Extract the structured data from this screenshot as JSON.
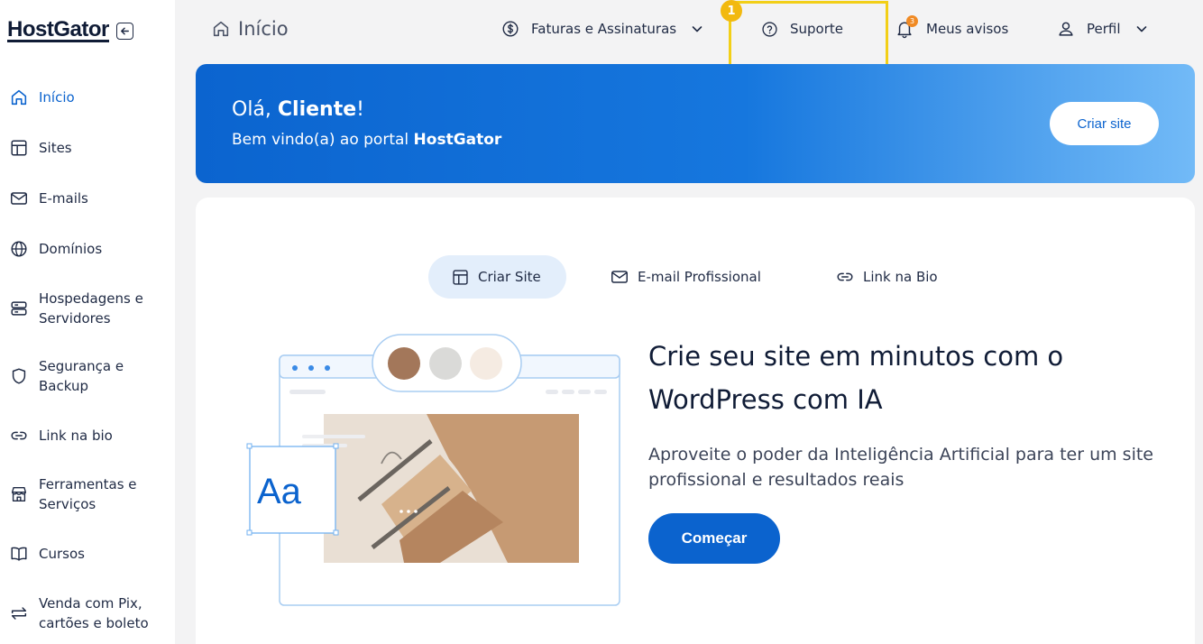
{
  "brand": {
    "logo": "HostGator"
  },
  "sidebar": {
    "items": [
      {
        "label": "Início",
        "icon": "home-icon",
        "active": true
      },
      {
        "label": "Sites",
        "icon": "layout-icon"
      },
      {
        "label": "E-mails",
        "icon": "mail-icon"
      },
      {
        "label": "Domínios",
        "icon": "globe-icon"
      },
      {
        "label": "Hospedagens e Servidores",
        "icon": "server-icon"
      },
      {
        "label": "Segurança e Backup",
        "icon": "shield-icon"
      },
      {
        "label": "Link na bio",
        "icon": "link-icon"
      },
      {
        "label": "Ferramentas e Serviços",
        "icon": "store-icon"
      },
      {
        "label": "Cursos",
        "icon": "book-icon"
      },
      {
        "label": "Venda com Pix, cartões e boleto",
        "icon": "transfer-icon"
      }
    ]
  },
  "header": {
    "title": "Início",
    "nav": {
      "billing": "Faturas e Assinaturas",
      "support": "Suporte",
      "notices": "Meus avisos",
      "notices_count": "3",
      "profile": "Perfil"
    },
    "step_badge": "1"
  },
  "banner": {
    "greeting_prefix": "Olá, ",
    "greeting_name": "Cliente",
    "greeting_suffix": "!",
    "welcome_prefix": "Bem vindo(a) ao portal ",
    "welcome_brand": "HostGator",
    "cta": "Criar site"
  },
  "main": {
    "tabs": [
      {
        "label": "Criar Site",
        "icon": "layout-icon",
        "active": true
      },
      {
        "label": "E-mail Profissional",
        "icon": "mail-icon"
      },
      {
        "label": "Link na Bio",
        "icon": "link-icon"
      }
    ],
    "hero_title": "Crie seu site em minutos com o WordPress com IA",
    "hero_desc": "Aproveite o poder da Inteligência Artificial para ter um site profissional e resultados reais",
    "cta": "Começar",
    "illustration": {
      "font_sample": "Aa",
      "swatches": [
        "#a3775a",
        "#dadad8",
        "#f5ebe2"
      ]
    }
  },
  "colors": {
    "accent": "#0b63ce",
    "highlight": "#f2cf17",
    "badge": "#f2b90f"
  }
}
